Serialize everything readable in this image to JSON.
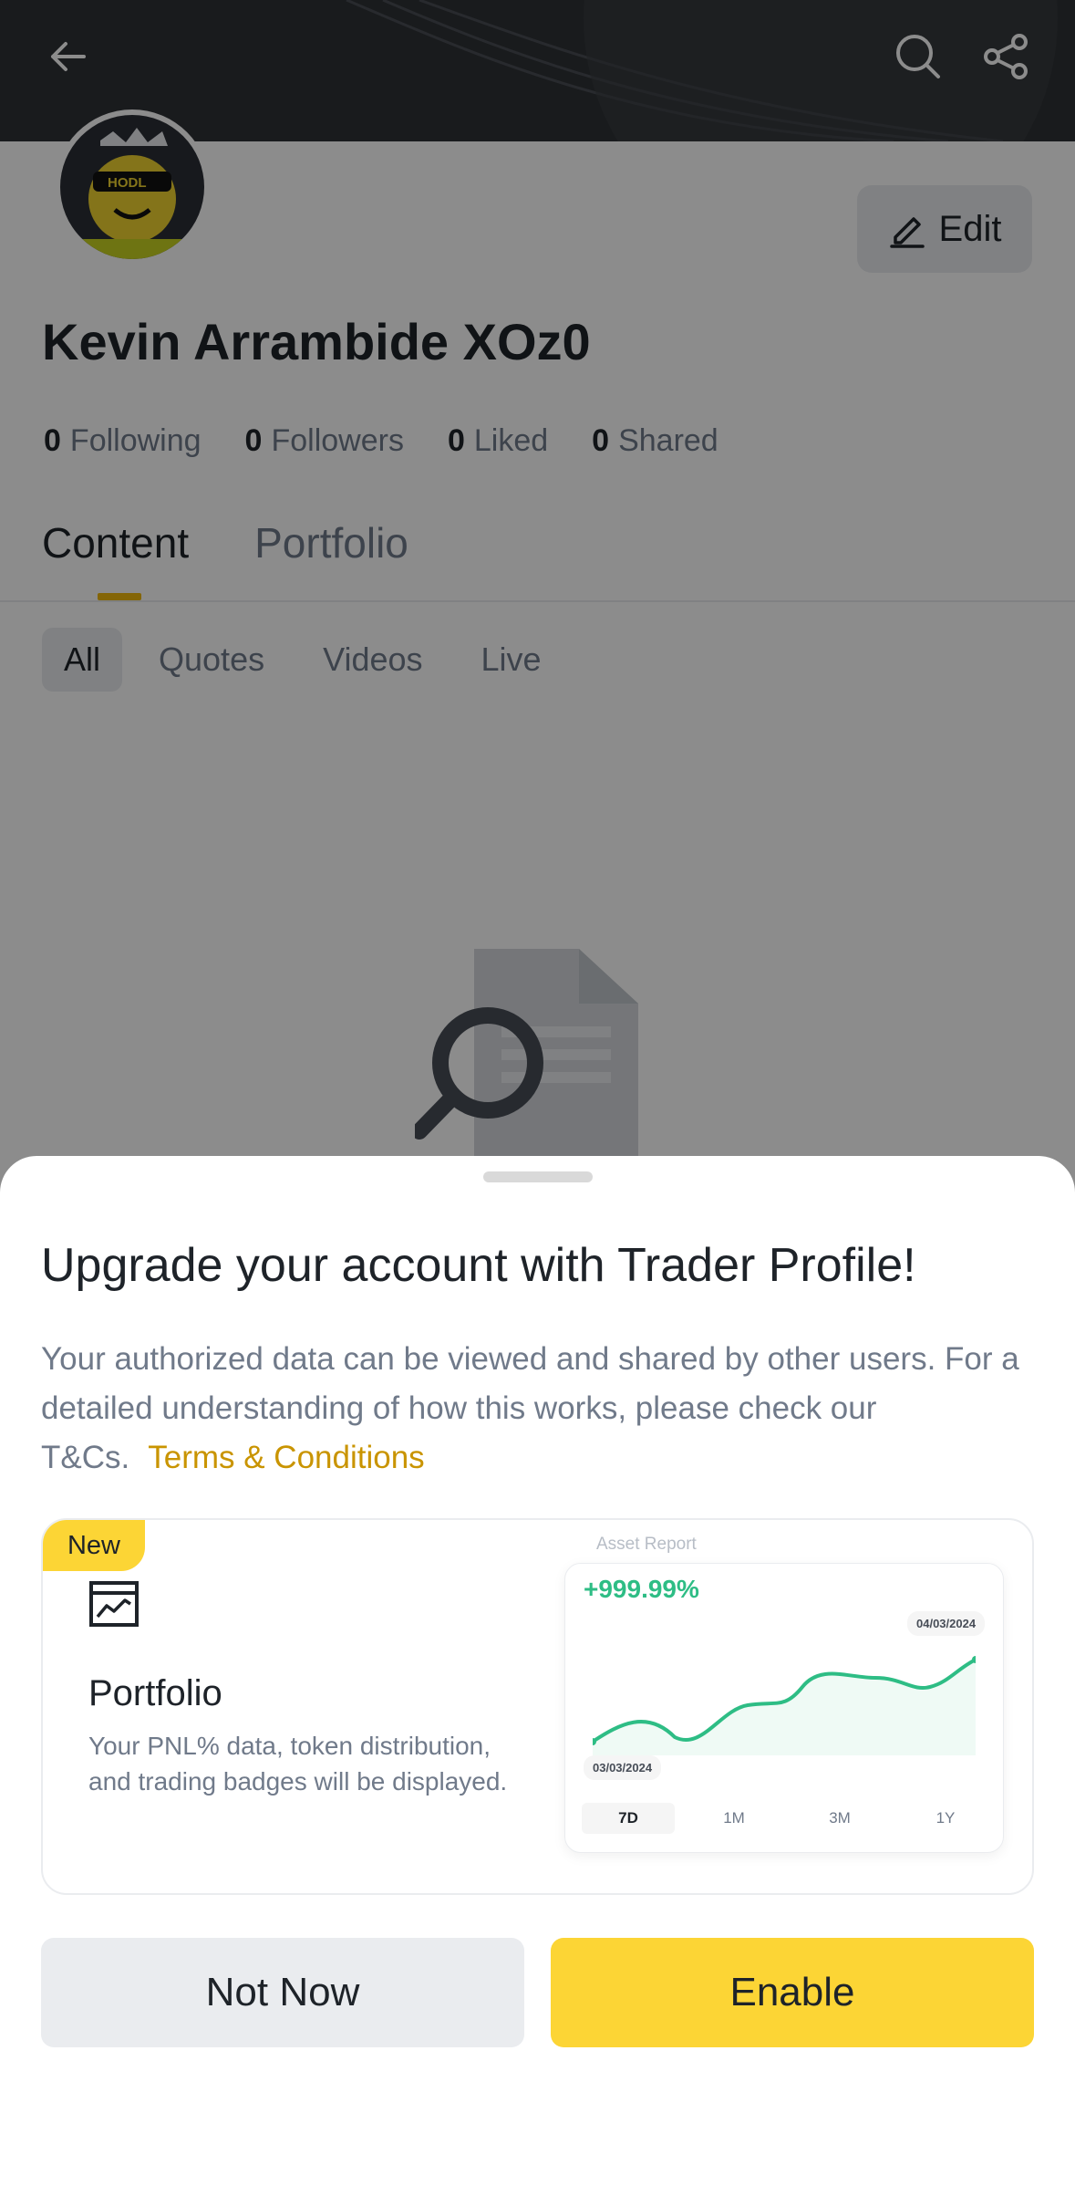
{
  "profile": {
    "name": "Kevin Arrambide XOz0",
    "edit_label": "Edit",
    "stats": [
      {
        "count": "0",
        "label": "Following"
      },
      {
        "count": "0",
        "label": "Followers"
      },
      {
        "count": "0",
        "label": "Liked"
      },
      {
        "count": "0",
        "label": "Shared"
      }
    ],
    "tabs": [
      {
        "label": "Content",
        "active": true
      },
      {
        "label": "Portfolio",
        "active": false
      }
    ],
    "subtabs": [
      {
        "label": "All",
        "active": true
      },
      {
        "label": "Quotes",
        "active": false
      },
      {
        "label": "Videos",
        "active": false
      },
      {
        "label": "Live",
        "active": false
      }
    ],
    "avatar_text": "HODL"
  },
  "sheet": {
    "title": "Upgrade your account with Trader Profile!",
    "description": "Your authorized data can be viewed and shared by other users. For a detailed understanding of how this works, please check our T&Cs.",
    "link_label": "Terms & Conditions",
    "card": {
      "badge": "New",
      "title": "Portfolio",
      "description": "Your PNL% data, token distribution, and trading badges will be displayed.",
      "icon": "chart-frame-icon",
      "preview": {
        "header": "Asset Report",
        "pnl": "+999.99%",
        "start_date": "03/03/2024",
        "end_date": "04/03/2024",
        "periods": [
          "7D",
          "1M",
          "3M",
          "1Y"
        ],
        "active_period": "7D"
      }
    },
    "buttons": {
      "secondary": "Not Now",
      "primary": "Enable"
    }
  },
  "colors": {
    "accent": "#fcd535",
    "link": "#c99400",
    "positive": "#2ebd85",
    "tab_indicator": "#f0b90b"
  }
}
